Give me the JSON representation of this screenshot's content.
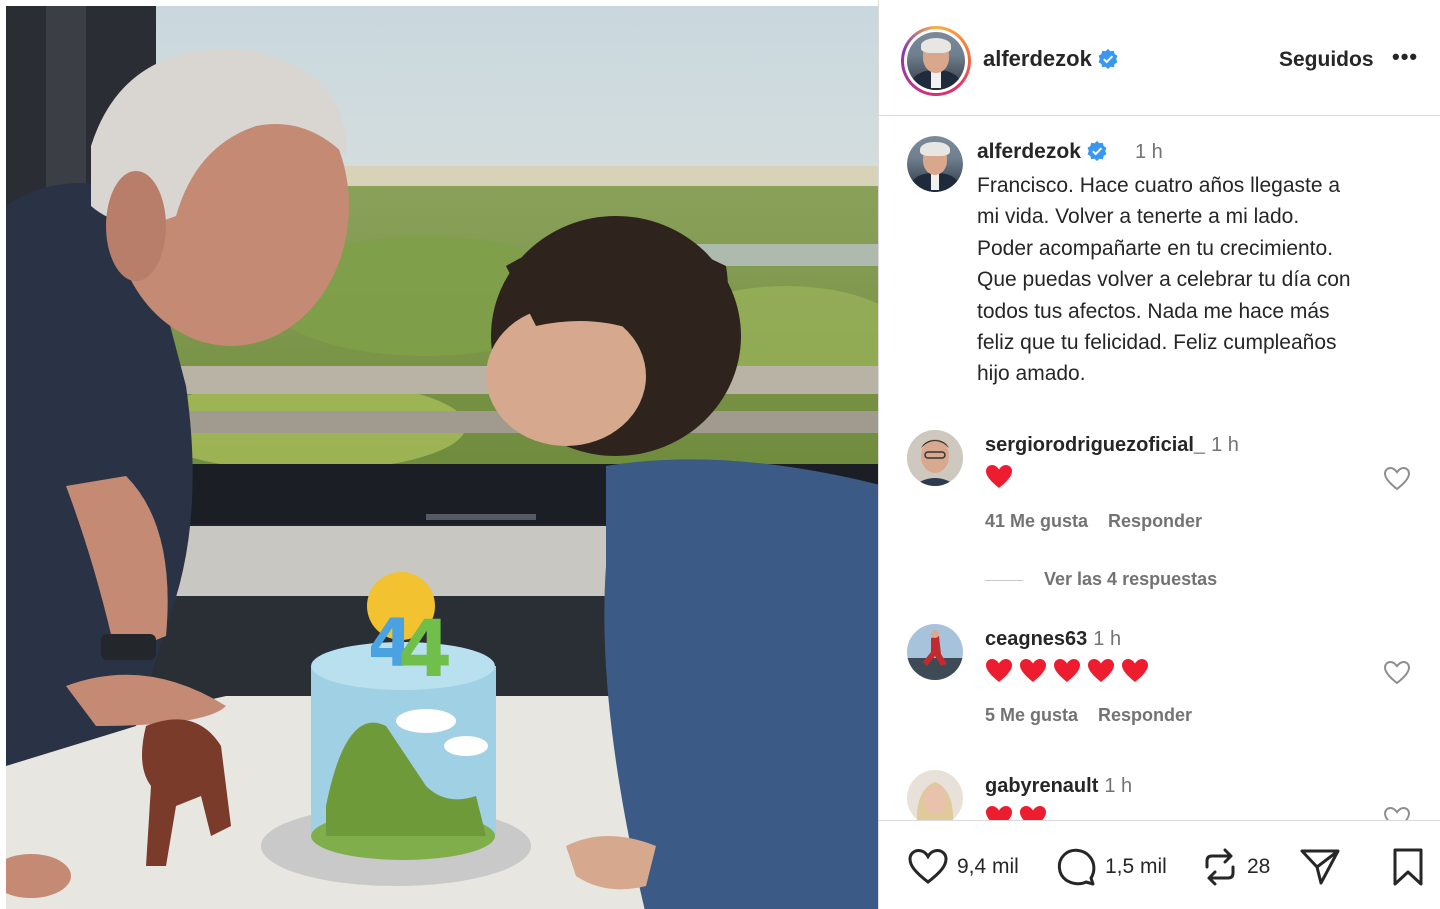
{
  "post": {
    "username": "alferdezok",
    "follow_label": "Seguidos",
    "more_label": "•••",
    "caption_time": "1 h",
    "caption_lines": [
      "Francisco. Hace cuatro años llegaste a",
      "mi vida. Volver a tenerte a mi lado.",
      "Poder acompañarte en tu crecimiento.",
      "Que puedas volver a celebrar tu día con",
      "todos tus afectos. Nada me hace más",
      "feliz que tu felicidad. Feliz cumpleaños",
      "hijo amado."
    ]
  },
  "comments": [
    {
      "username": "sergiorodriguezoficial_",
      "time": "1 h",
      "hearts": 1,
      "likes": "41 Me gusta",
      "reply": "Responder",
      "view_replies": "Ver las 4 respuestas"
    },
    {
      "username": "ceagnes63",
      "time": "1 h",
      "hearts": 5,
      "likes": "5 Me gusta",
      "reply": "Responder"
    },
    {
      "username": "gabyrenault",
      "time": "1 h",
      "hearts": 2
    }
  ],
  "actions": {
    "likes": "9,4 mil",
    "comments": "1,5 mil",
    "reposts": "28"
  },
  "colors": {
    "accent_verified": "#3897f0",
    "heart": "#ed1c2e",
    "text": "#262626",
    "muted": "#737373"
  }
}
